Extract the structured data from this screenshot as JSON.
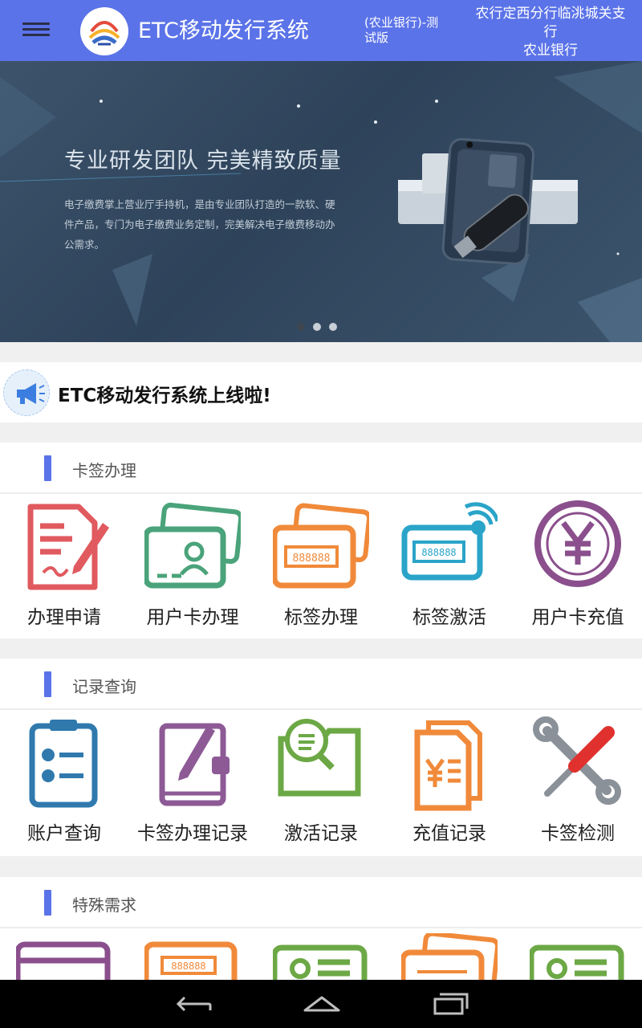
{
  "header": {
    "title": "ETC移动发行系统",
    "version": "(农业银行)-测试版",
    "branch_line1": "农行定西分行临洮城关支行",
    "branch_line2": "农业银行",
    "menu_icon": "menu-icon",
    "accent_color": "#5b73e8"
  },
  "banner": {
    "headline": "专业研发团队 完美精致质量",
    "description": "电子缴费掌上营业厅手持机，是由专业团队打造的一款软、硬件产品，专门为电子缴费业务定制，完美解决电子缴费移动办公需求。",
    "slide_count": 3,
    "active_slide": 1
  },
  "notice": {
    "text": "ETC移动发行系统上线啦!",
    "icon": "megaphone-icon"
  },
  "sections": [
    {
      "title": "卡签办理",
      "items": [
        {
          "label": "办理申请",
          "icon": "application-form-icon",
          "color": "#e05a5f"
        },
        {
          "label": "用户卡办理",
          "icon": "user-card-icon",
          "color": "#4aa37a"
        },
        {
          "label": "标签办理",
          "icon": "tag-card-icon",
          "color": "#f08a3a"
        },
        {
          "label": "标签激活",
          "icon": "tag-activate-icon",
          "color": "#2aa4c8"
        },
        {
          "label": "用户卡充值",
          "icon": "yuan-recharge-icon",
          "color": "#8a4f8c"
        }
      ]
    },
    {
      "title": "记录查询",
      "items": [
        {
          "label": "账户查询",
          "icon": "clipboard-check-icon",
          "color": "#2f79ad"
        },
        {
          "label": "卡签办理记录",
          "icon": "notebook-pen-icon",
          "color": "#8d5a96"
        },
        {
          "label": "激活记录",
          "icon": "folder-search-icon",
          "color": "#6ca845"
        },
        {
          "label": "充值记录",
          "icon": "yuan-document-icon",
          "color": "#f08a3a"
        },
        {
          "label": "卡签检测",
          "icon": "wrench-screwdriver-icon",
          "color": "#e0312e"
        }
      ]
    },
    {
      "title": "特殊需求",
      "items": [
        {
          "label": "",
          "icon": "card-reader-icon",
          "color": "#8a4f8c"
        },
        {
          "label": "",
          "icon": "tag-card-icon",
          "color": "#f08a3a"
        },
        {
          "label": "",
          "icon": "id-card-icon",
          "color": "#6ca845"
        },
        {
          "label": "",
          "icon": "tag-card-stack-icon",
          "color": "#f08a3a"
        },
        {
          "label": "",
          "icon": "id-card-icon",
          "color": "#6ca845"
        }
      ]
    }
  ],
  "navbar": {
    "back_icon": "back-icon",
    "home_icon": "home-icon",
    "recents_icon": "recents-icon"
  }
}
